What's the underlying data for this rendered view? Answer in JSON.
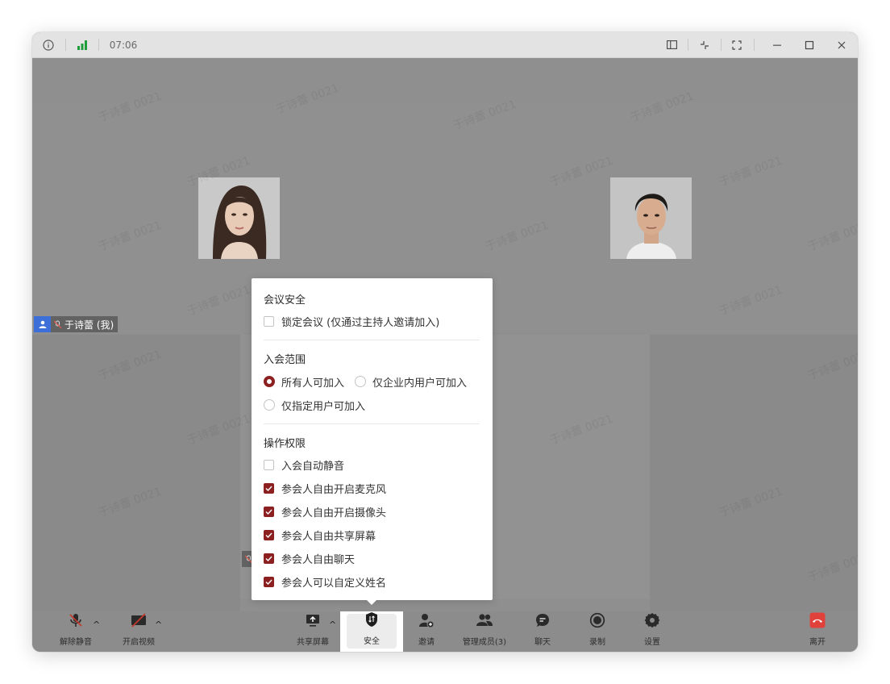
{
  "titlebar": {
    "time": "07:06"
  },
  "participants": [
    {
      "name": "于诗蕾 (我)"
    }
  ],
  "watermark_text": "于诗蕾 0021",
  "security_panel": {
    "section1_title": "会议安全",
    "lock_meeting": {
      "label": "锁定会议 (仅通过主持人邀请加入)",
      "checked": false
    },
    "section2_title": "入会范围",
    "scope_options": [
      {
        "label": "所有人可加入",
        "selected": true
      },
      {
        "label": "仅企业内用户可加入",
        "selected": false
      },
      {
        "label": "仅指定用户可加入",
        "selected": false
      }
    ],
    "section3_title": "操作权限",
    "permissions": [
      {
        "label": "入会自动静音",
        "checked": false
      },
      {
        "label": "参会人自由开启麦克风",
        "checked": true
      },
      {
        "label": "参会人自由开启摄像头",
        "checked": true
      },
      {
        "label": "参会人自由共享屏幕",
        "checked": true
      },
      {
        "label": "参会人自由聊天",
        "checked": true
      },
      {
        "label": "参会人可以自定义姓名",
        "checked": true
      }
    ]
  },
  "toolbar": {
    "unmute": "解除静音",
    "start_video": "开启视频",
    "share_screen": "共享屏幕",
    "security": "安全",
    "invite": "邀请",
    "manage_members": "管理成员(3)",
    "chat": "聊天",
    "record": "录制",
    "settings": "设置",
    "leave": "离开"
  },
  "colors": {
    "accent": "#8c2020",
    "leave": "#e0413a",
    "signal": "#1f9d3a"
  }
}
